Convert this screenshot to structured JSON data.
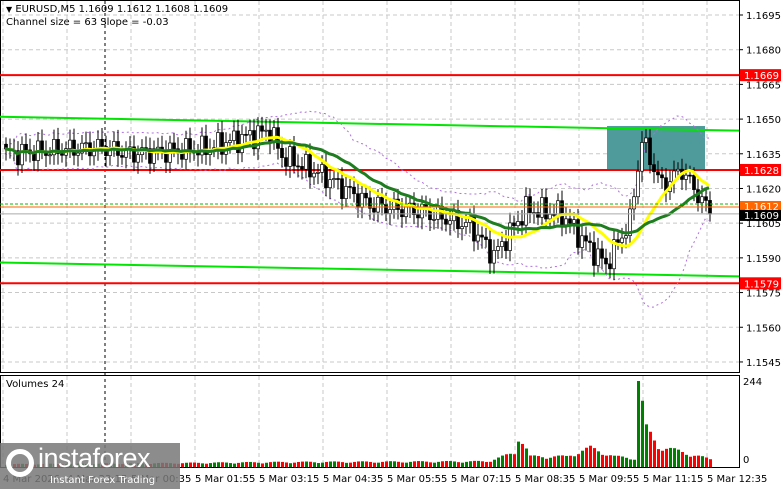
{
  "header": {
    "symbol_line": "EURUSD,M5  1.1609 1.1612 1.1608 1.1609",
    "indicator_line": "Channel size = 63 Slope = -0.03"
  },
  "volume_panel": {
    "label": "Volumes 24",
    "max_label": "244",
    "min_label": "0"
  },
  "logo": {
    "name": "instaforex",
    "tagline": "Instant Forex Trading"
  },
  "colors": {
    "bull": "#008000",
    "bear": "#ff0000",
    "level": "#ff0000",
    "channel": "#00e600",
    "ma_fast": "#ffff00",
    "ma_slow": "#1e7d1e",
    "box": "#4f9a9a"
  },
  "chart_data": {
    "type": "candlestick",
    "symbol": "EURUSD",
    "timeframe": "M5",
    "ylim": [
      1.1538,
      1.1702
    ],
    "price_ticks": [
      "1.1695",
      "1.1680",
      "1.1665",
      "1.1650",
      "1.1635",
      "1.1620",
      "1.1605",
      "1.1590",
      "1.1575",
      "1.1560",
      "1.1545"
    ],
    "time_labels": [
      {
        "bar": -1,
        "label": "4 Mar 2026"
      },
      {
        "bar": 15,
        "label": "4 Mar 23:15"
      },
      {
        "bar": 31,
        "label": "5 Mar 00:35"
      },
      {
        "bar": 47,
        "label": "5 Mar 01:55"
      },
      {
        "bar": 63,
        "label": "5 Mar 03:15"
      },
      {
        "bar": 79,
        "label": "5 Mar 04:35"
      },
      {
        "bar": 95,
        "label": "5 Mar 05:55"
      },
      {
        "bar": 111,
        "label": "5 Mar 07:15"
      },
      {
        "bar": 127,
        "label": "5 Mar 08:35"
      },
      {
        "bar": 143,
        "label": "5 Mar 09:55"
      },
      {
        "bar": 159,
        "label": "5 Mar 11:15"
      },
      {
        "bar": 175,
        "label": "5 Mar 12:35"
      }
    ],
    "bar_count": 177,
    "price_path": [
      [
        0,
        1.1635
      ],
      [
        24,
        1.1638
      ],
      [
        31,
        1.1635
      ],
      [
        49,
        1.1637
      ],
      [
        66,
        1.1645
      ],
      [
        69,
        1.1634
      ],
      [
        79,
        1.1626
      ],
      [
        91,
        1.1613
      ],
      [
        104,
        1.161
      ],
      [
        116,
        1.1604
      ],
      [
        122,
        1.1591
      ],
      [
        130,
        1.1611
      ],
      [
        139,
        1.1609
      ],
      [
        144,
        1.1598
      ],
      [
        150,
        1.1587
      ],
      [
        156,
        1.1606
      ],
      [
        159,
        1.1641
      ],
      [
        164,
        1.1621
      ],
      [
        169,
        1.1628
      ],
      [
        175,
        1.1612
      ],
      [
        176,
        1.1609
      ]
    ],
    "volume_path": [
      [
        0,
        8
      ],
      [
        30,
        10
      ],
      [
        70,
        14
      ],
      [
        120,
        16
      ],
      [
        127,
        40
      ],
      [
        128,
        95
      ],
      [
        131,
        30
      ],
      [
        140,
        30
      ],
      [
        146,
        55
      ],
      [
        152,
        30
      ],
      [
        157,
        25
      ],
      [
        158,
        244
      ],
      [
        160,
        110
      ],
      [
        163,
        60
      ],
      [
        170,
        40
      ],
      [
        176,
        22
      ]
    ],
    "levels": [
      {
        "price": 1.1669,
        "label": "1.1669",
        "color": "#ff0000"
      },
      {
        "price": 1.1628,
        "label": "1.1628",
        "color": "#ff0000"
      },
      {
        "price": 1.1579,
        "label": "1.1579",
        "color": "#ff0000"
      }
    ],
    "channel_upper": [
      1.1651,
      1.1645
    ],
    "channel_lower": [
      1.1588,
      1.1582
    ],
    "box": {
      "bar_from": 150,
      "bar_to": 175,
      "price_top": 1.1647,
      "price_bottom": 1.1628
    },
    "ask": {
      "price": 1.1612,
      "label": "1.1612"
    },
    "bid": {
      "price": 1.1609,
      "label": "1.1609"
    },
    "session_separator_bar": 25
  }
}
